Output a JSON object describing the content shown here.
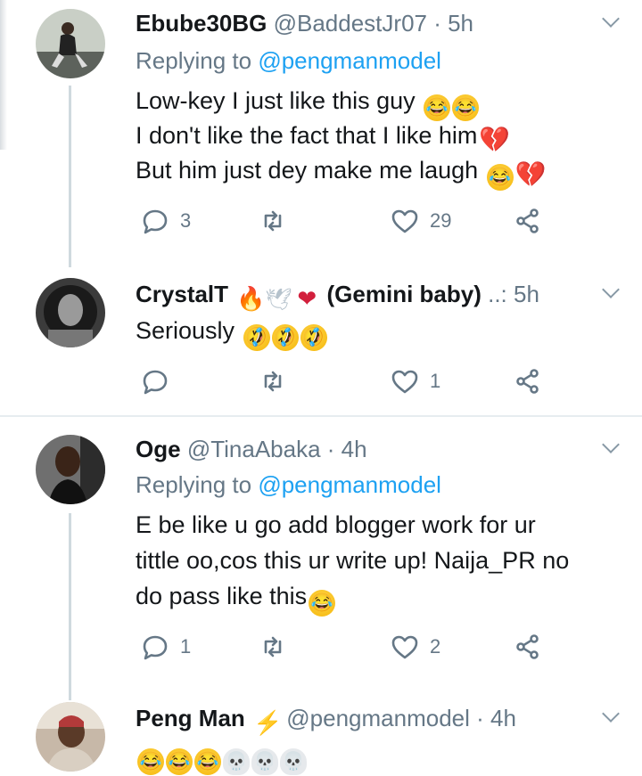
{
  "tweets": [
    {
      "name": "Ebube30BG",
      "handle": "@BaddestJr07 · 5h",
      "replying_prefix": "Replying to ",
      "replying_to": "@pengmanmodel",
      "lines": [
        "Low-key I just like this guy",
        "I don't like the fact that I like him",
        "But him just dey make me laugh"
      ],
      "emoji_lines": [
        [
          "face-with-tears-of-joy",
          "face-with-tears-of-joy"
        ],
        [
          "broken-heart"
        ],
        [
          "face-with-tears-of-joy",
          "broken-heart"
        ]
      ],
      "reply_count": "3",
      "retweet_count": "",
      "like_count": "29"
    },
    {
      "name": "CrystalT",
      "name_emojis": [
        "fire",
        "dove",
        "red-heart"
      ],
      "name_suffix": "(Gemini baby)",
      "handle": "..: 5h",
      "lines": [
        "Seriously"
      ],
      "emoji_lines": [
        [
          "rolling-on-floor-laughing",
          "rolling-on-floor-laughing",
          "rolling-on-floor-laughing"
        ]
      ],
      "reply_count": "",
      "retweet_count": "",
      "like_count": "1"
    },
    {
      "name": "Oge",
      "handle": "@TinaAbaka · 4h",
      "replying_prefix": "Replying to ",
      "replying_to": "@pengmanmodel",
      "lines": [
        "E be like u go add blogger work for ur",
        "tittle oo,cos this ur write up! Naija_PR no",
        "do pass like this"
      ],
      "emoji_lines": [
        [],
        [],
        [
          "face-with-tears-of-joy"
        ]
      ],
      "reply_count": "1",
      "retweet_count": "",
      "like_count": "2"
    },
    {
      "name": "Peng Man",
      "name_emojis": [
        "lightning"
      ],
      "handle": "@pengmanmodel · 4h",
      "lines": [
        ""
      ],
      "emoji_lines": [
        [
          "face-with-tears-of-joy",
          "face-with-tears-of-joy",
          "face-with-tears-of-joy",
          "skull",
          "skull",
          "skull"
        ]
      ]
    }
  ],
  "colors": {
    "accent": "#1da1f2",
    "muted": "#657786",
    "text": "#14171a",
    "thread": "#cfd9de",
    "divider": "#e6ecf0"
  }
}
